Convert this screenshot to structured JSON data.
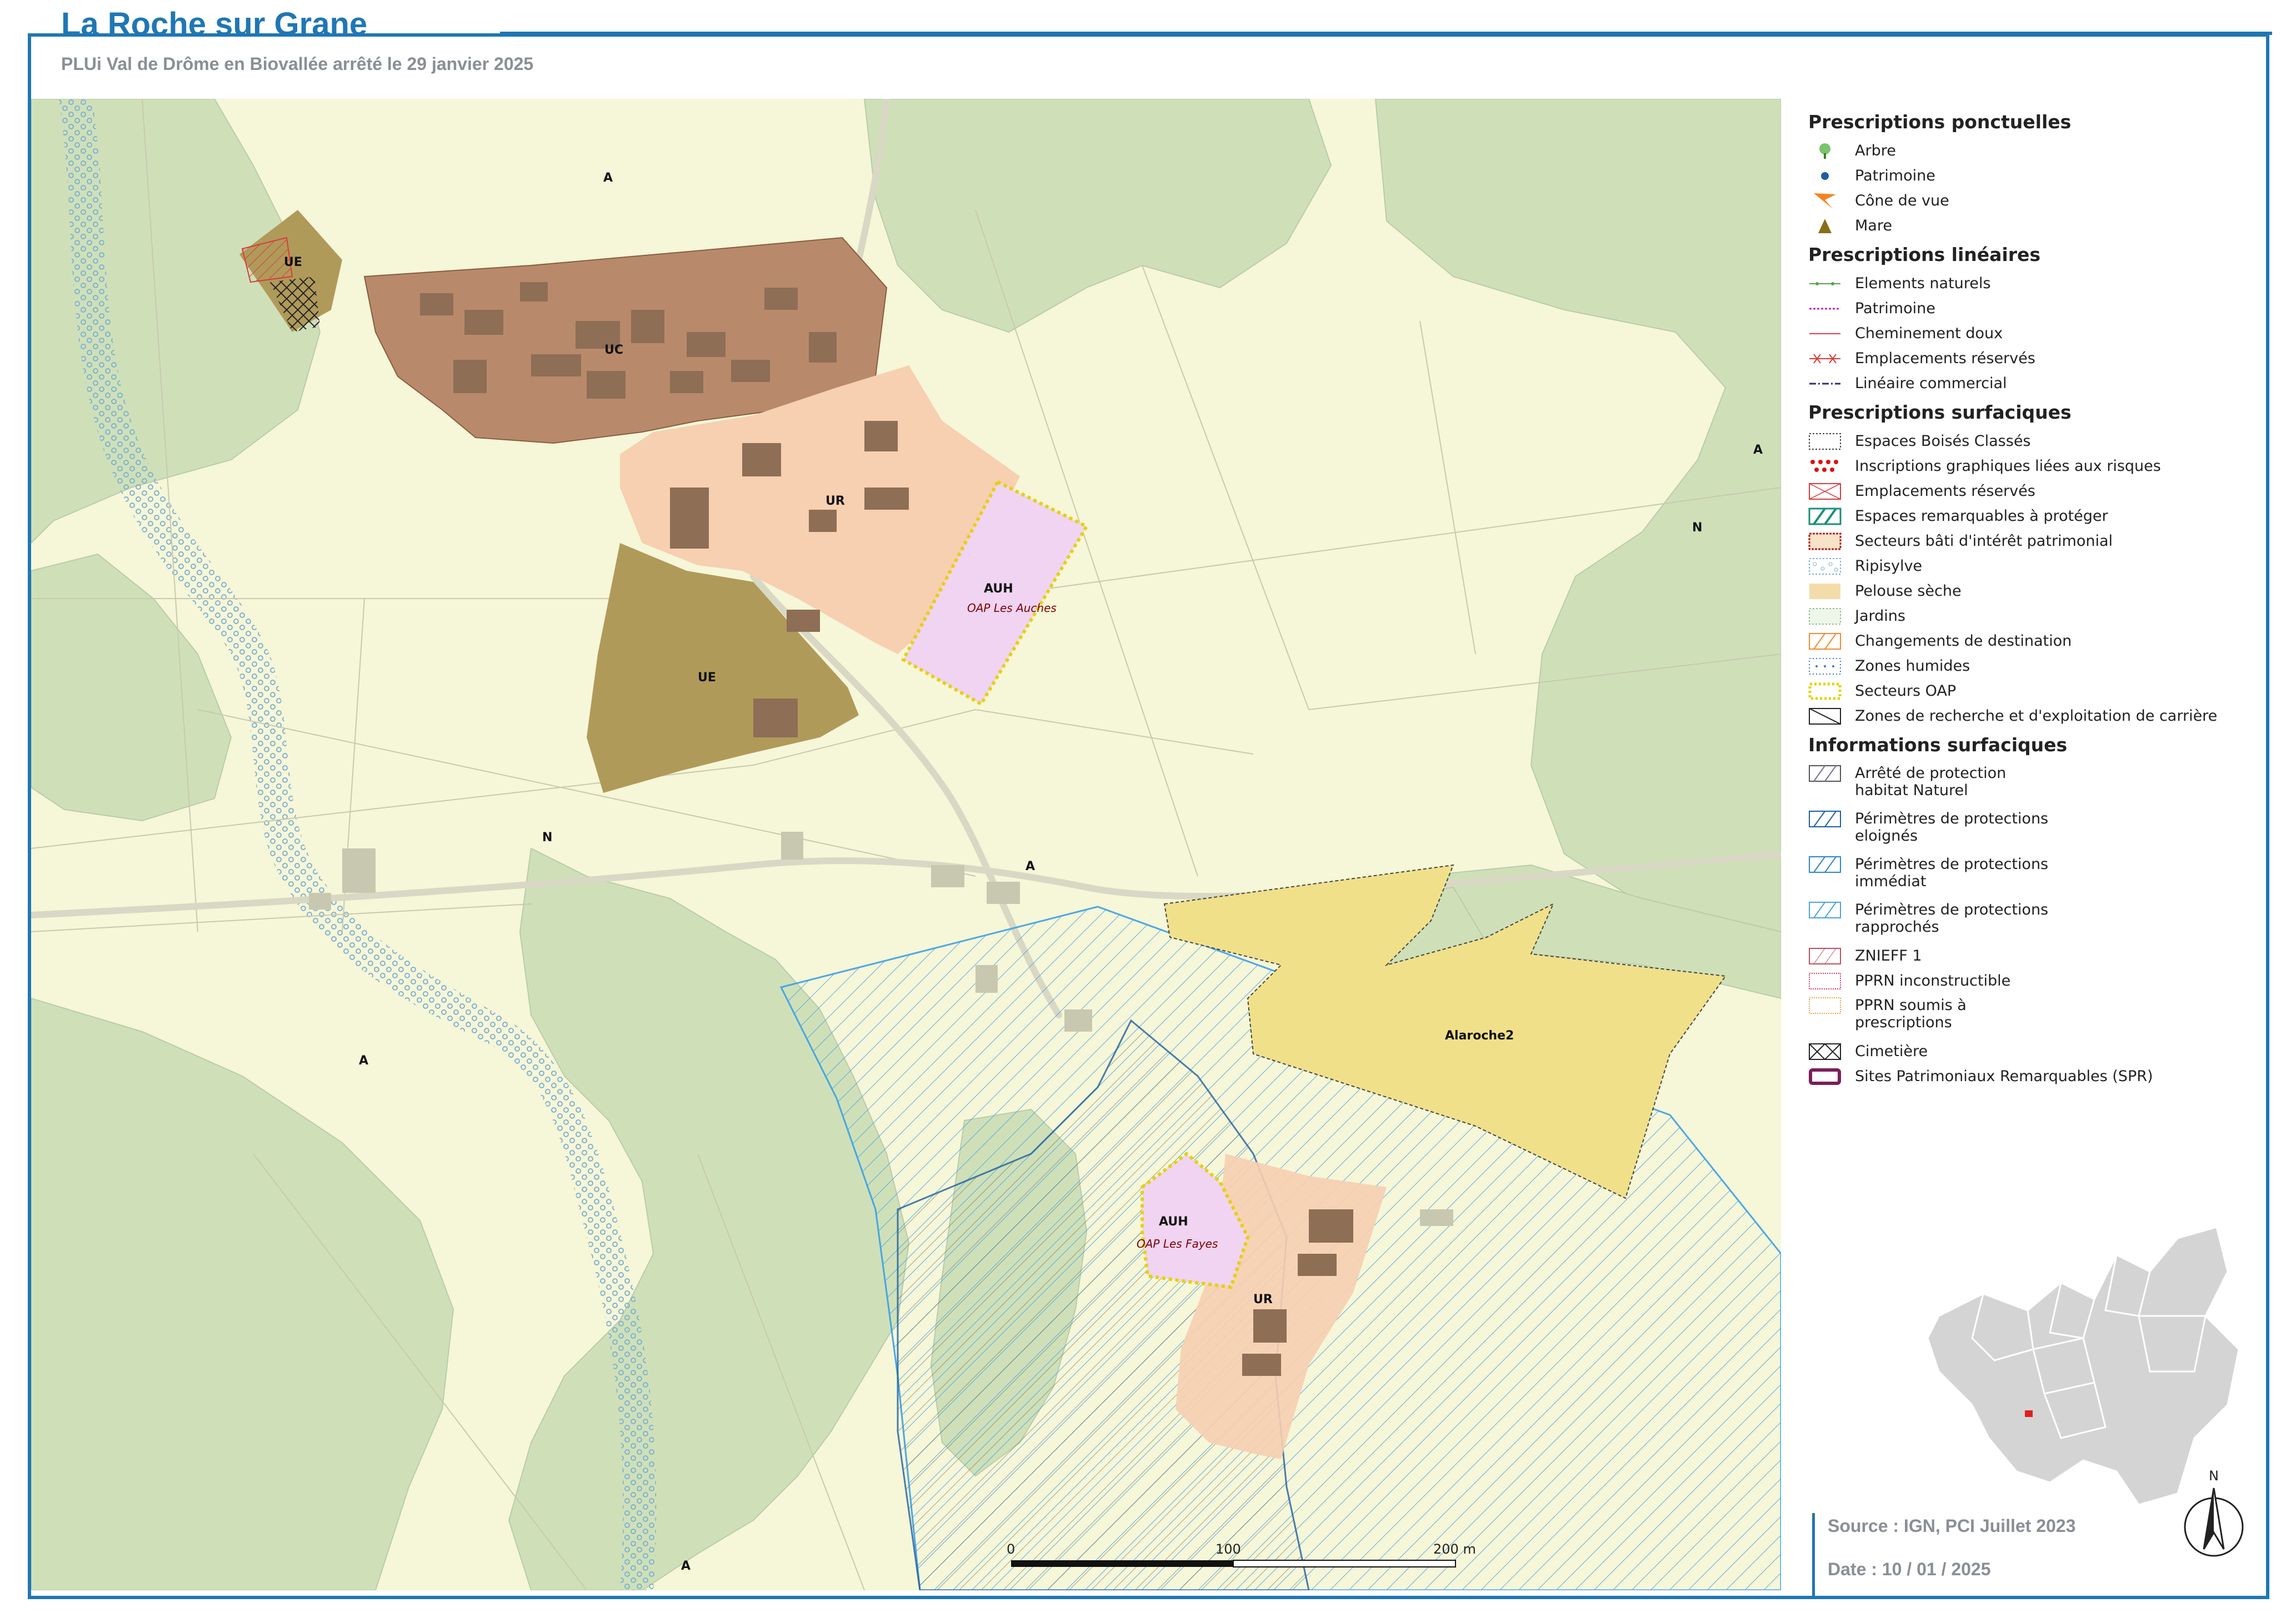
{
  "header": {
    "title": "La Roche sur Grane",
    "subtitle": "PLUi Val de Drôme en Biovallée arrêté le 29 janvier 2025"
  },
  "colors": {
    "frame": "#1f77b4",
    "agri": "#f6f6d8",
    "forest": "#cfe0b9",
    "uc": "#b88a6b",
    "ue": "#b09a5a",
    "ur": "#f7cfb1",
    "auh": "#f0d4f2",
    "quarry": "#f1e08a",
    "building": "#8e6e55",
    "protection": "#3aa0e6"
  },
  "map": {
    "zone_labels": {
      "a1": "A",
      "a2": "A",
      "a3": "A",
      "a4": "A",
      "a5": "A",
      "n1": "N",
      "n2": "N",
      "uc": "UC",
      "ue1": "UE",
      "ue2": "UE",
      "ur1": "UR",
      "ur2": "UR",
      "auh1": "AUH",
      "auh2": "AUH",
      "quarry": "Alaroche2"
    },
    "oap_labels": {
      "auches": "OAP Les Auches",
      "fayes": "OAP Les Fayes"
    }
  },
  "legend": {
    "ponctuelles": {
      "title": "Prescriptions ponctuelles",
      "items": [
        "Arbre",
        "Patrimoine",
        "Cône de vue",
        "Mare"
      ]
    },
    "lineaires": {
      "title": "Prescriptions linéaires",
      "items": [
        "Elements naturels",
        "Patrimoine",
        "Cheminement doux",
        "Emplacements réservés",
        "Linéaire commercial"
      ]
    },
    "surfaciques": {
      "title": "Prescriptions surfaciques",
      "items": [
        "Espaces Boisés Classés",
        "Inscriptions graphiques liées aux risques",
        "Emplacements réservés",
        "Espaces remarquables à protéger",
        "Secteurs bâti d'intérêt patrimonial",
        "Ripisylve",
        "Pelouse sèche",
        "Jardins",
        "Changements de destination",
        "Zones humides",
        "Secteurs OAP",
        "Zones de recherche et d'exploitation de carrière"
      ]
    },
    "informations": {
      "title": "Informations surfaciques",
      "items": [
        "Arrêté de protection habitat Naturel",
        "Périmètres de protections eloignés",
        "Périmètres de protections immédiat",
        "Périmètres de protections rapprochés",
        "ZNIEFF 1",
        "PPRN inconstructible",
        "PPRN soumis à prescriptions",
        "Cimetière",
        "Sites Patrimoniaux Remarquables (SPR)"
      ]
    }
  },
  "scale": {
    "zero": "0",
    "mid": "100",
    "end": "200 m"
  },
  "north_label": "N",
  "source": "Source : IGN, PCI Juillet 2023",
  "date": "Date : 10 / 01 / 2025"
}
